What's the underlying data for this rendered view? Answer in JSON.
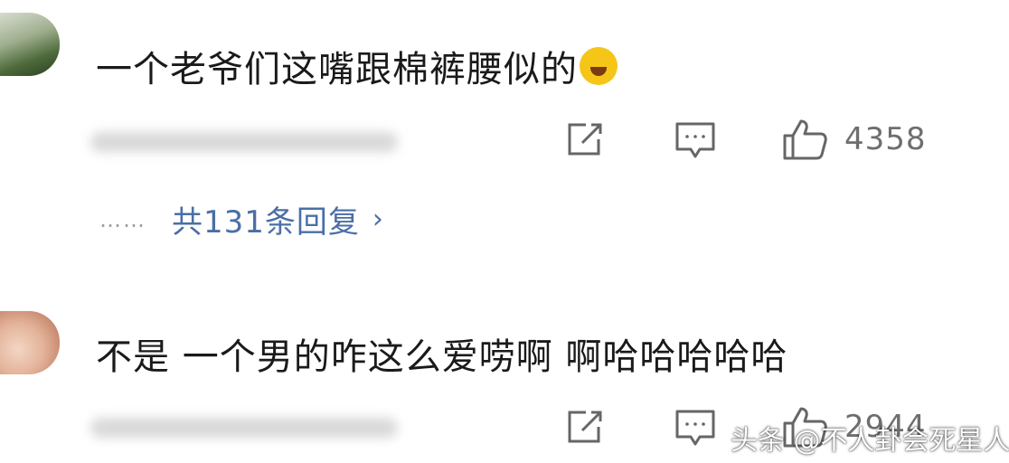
{
  "comments": [
    {
      "text": "一个老爷们这嘴跟棉裤腰似的",
      "emoji": "laugh-cry-emoji",
      "likes": "4358",
      "replies_label": "共131条回复",
      "replies_dots": "……",
      "replies_chevron": "›"
    },
    {
      "text": "不是 一个男的咋这么爱唠啊 啊哈哈哈哈哈",
      "likes": "2944"
    }
  ],
  "watermark": "头条 @不人卦会死星人",
  "icons": {
    "share": "share-icon",
    "comment": "comment-icon",
    "like": "thumbs-up-icon"
  },
  "colors": {
    "link": "#4a6fa5",
    "icon": "#666666",
    "text": "#1a1a1a"
  }
}
